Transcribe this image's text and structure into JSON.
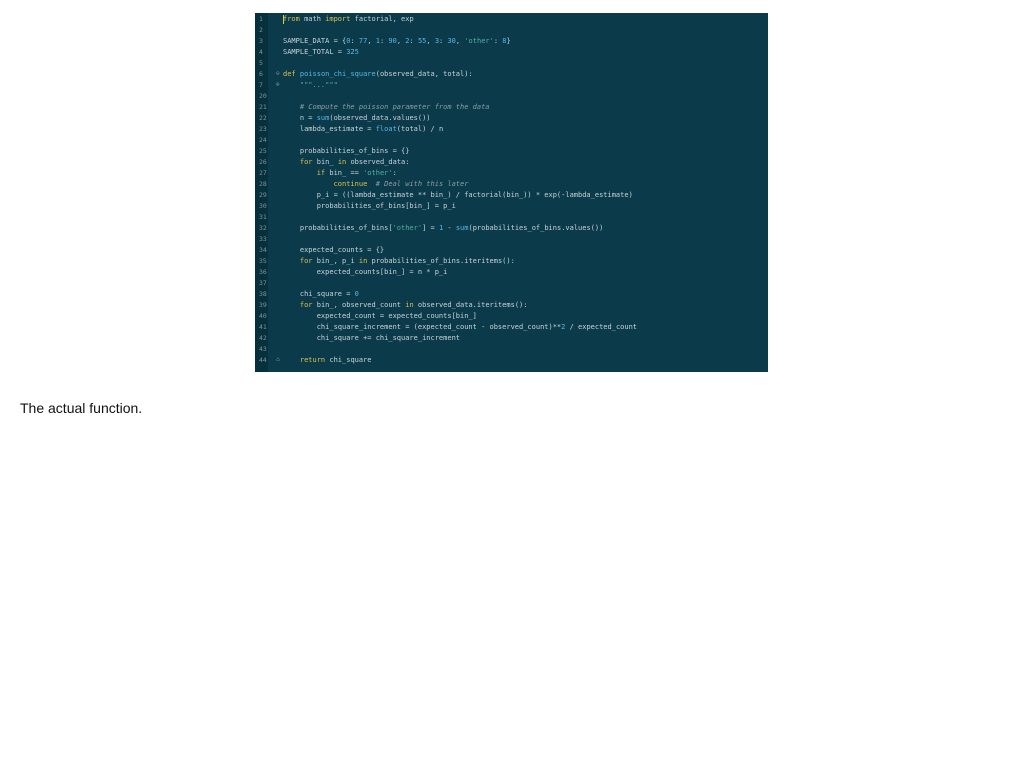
{
  "caption": "The actual function.",
  "editor": {
    "lines": [
      {
        "n": "1",
        "html": "<span class=\"kw\">from</span> math <span class=\"kw\">import</span> factorial, exp"
      },
      {
        "n": "2",
        "html": ""
      },
      {
        "n": "3",
        "html": "SAMPLE_DATA = {<span class=\"num\">0</span>: <span class=\"num\">77</span>, <span class=\"num\">1</span>: <span class=\"num\">90</span>, <span class=\"num\">2</span>: <span class=\"num\">55</span>, <span class=\"num\">3</span>: <span class=\"num\">30</span>, <span class=\"str\">'other'</span>: <span class=\"num\">8</span>}"
      },
      {
        "n": "4",
        "html": "SAMPLE_TOTAL = <span class=\"num\">325</span>"
      },
      {
        "n": "5",
        "html": ""
      },
      {
        "n": "6",
        "html": "<span class=\"kw\">def</span> <span class=\"fn\">poisson_chi_square</span>(observed_data, total):",
        "fold": "⊖"
      },
      {
        "n": "7",
        "html": "    <span class=\"str\">\"\"\"...\"\"\"</span>",
        "fold": "⊕"
      },
      {
        "n": "20",
        "html": ""
      },
      {
        "n": "21",
        "html": "    <span class=\"cm\"># Compute the poisson parameter from the data</span>"
      },
      {
        "n": "22",
        "html": "    n = <span class=\"fn\">sum</span>(observed_data.values())"
      },
      {
        "n": "23",
        "html": "    lambda_estimate = <span class=\"fn\">float</span>(total) / n"
      },
      {
        "n": "24",
        "html": ""
      },
      {
        "n": "25",
        "html": "    probabilities_of_bins = {}"
      },
      {
        "n": "26",
        "html": "    <span class=\"kw\">for</span> bin_ <span class=\"kw\">in</span> observed_data:"
      },
      {
        "n": "27",
        "html": "        <span class=\"kw\">if</span> bin_ == <span class=\"str\">'other'</span>:"
      },
      {
        "n": "28",
        "html": "            <span class=\"kw\">continue</span>  <span class=\"cm\"># Deal with this later</span>"
      },
      {
        "n": "29",
        "html": "        p_i = ((lambda_estimate ** bin_) / factorial(bin_)) * exp(-lambda_estimate)"
      },
      {
        "n": "30",
        "html": "        probabilities_of_bins[bin_] = p_i"
      },
      {
        "n": "31",
        "html": ""
      },
      {
        "n": "32",
        "html": "    probabilities_of_bins[<span class=\"str\">'other'</span>] = <span class=\"num\">1</span> - <span class=\"fn\">sum</span>(probabilities_of_bins.values())"
      },
      {
        "n": "33",
        "html": ""
      },
      {
        "n": "34",
        "html": "    expected_counts = {}"
      },
      {
        "n": "35",
        "html": "    <span class=\"kw\">for</span> bin_, p_i <span class=\"kw\">in</span> probabilities_of_bins.iteritems():"
      },
      {
        "n": "36",
        "html": "        expected_counts[bin_] = n * p_i"
      },
      {
        "n": "37",
        "html": ""
      },
      {
        "n": "38",
        "html": "    chi_square = <span class=\"num\">0</span>"
      },
      {
        "n": "39",
        "html": "    <span class=\"kw\">for</span> bin_, observed_count <span class=\"kw\">in</span> observed_data.iteritems():"
      },
      {
        "n": "40",
        "html": "        expected_count = expected_counts[bin_]"
      },
      {
        "n": "41",
        "html": "        chi_square_increment = (expected_count - observed_count)**<span class=\"num\">2</span> / expected_count"
      },
      {
        "n": "42",
        "html": "        chi_square += chi_square_increment"
      },
      {
        "n": "43",
        "html": ""
      },
      {
        "n": "44",
        "html": "    <span class=\"kw\">return</span> chi_square",
        "fold": "⌂"
      }
    ]
  }
}
